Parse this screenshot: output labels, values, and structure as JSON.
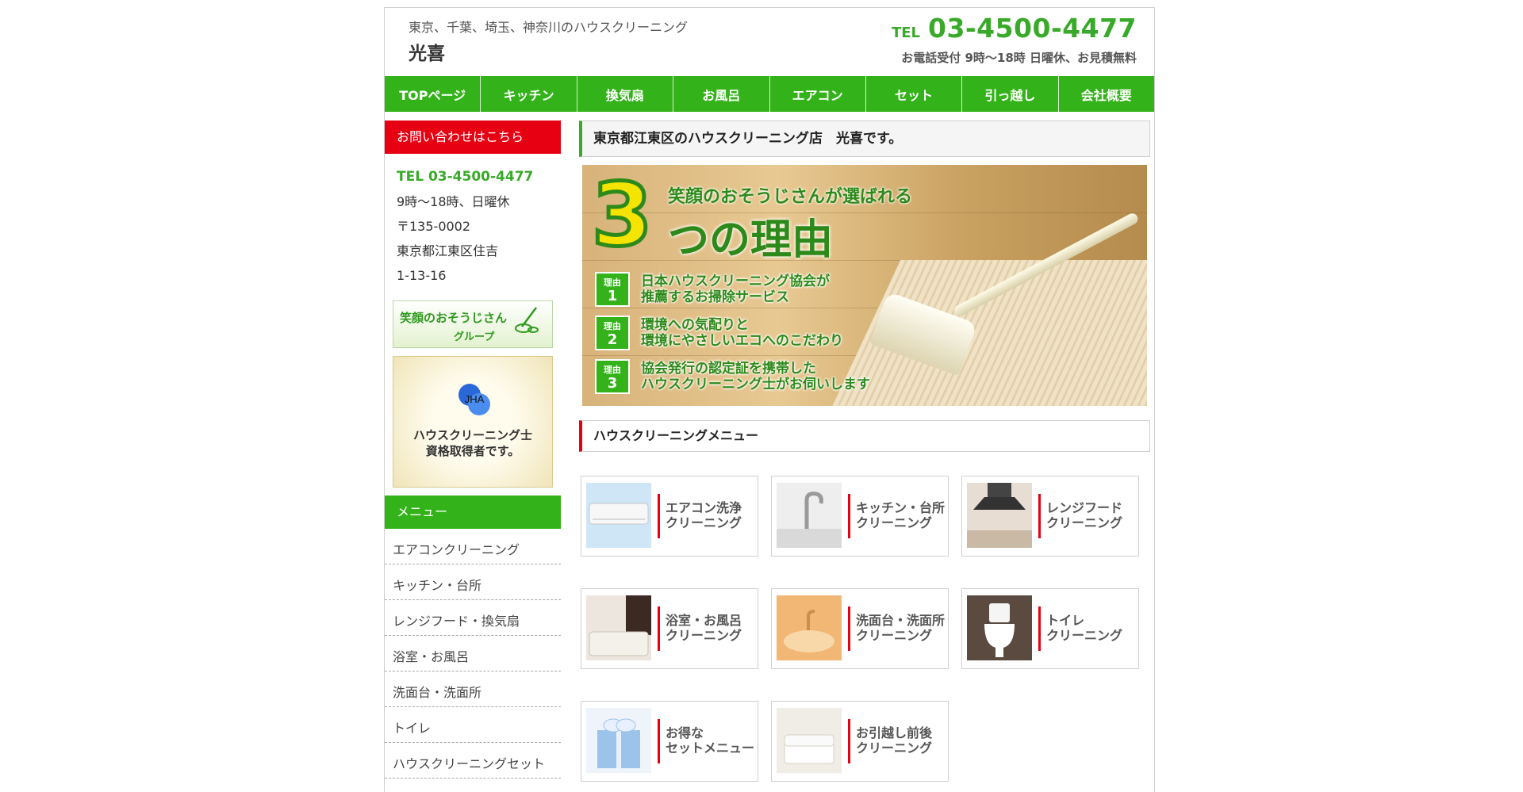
{
  "header": {
    "tagline": "東京、千葉、埼玉、神奈川のハウスクリーニング",
    "brand": "光喜",
    "tel_label": "TEL",
    "tel_number": "03-4500-4477",
    "tel_note": "お電話受付 9時～18時 日曜休、お見積無料"
  },
  "nav": [
    {
      "label": "TOPページ"
    },
    {
      "label": "キッチン"
    },
    {
      "label": "換気扇"
    },
    {
      "label": "お風呂"
    },
    {
      "label": "エアコン"
    },
    {
      "label": "セット"
    },
    {
      "label": "引っ越し"
    },
    {
      "label": "会社概要"
    }
  ],
  "sidebar": {
    "contact_heading": "お問い合わせはこちら",
    "tel": "TEL 03-4500-4477",
    "hours": "9時～18時、日曜休",
    "postal": "〒135-0002",
    "address1": "東京都江東区住吉",
    "address2": "1-13-16",
    "group_banner_line1": "笑顔のおそうじさん",
    "group_banner_line2": "グループ",
    "jha_logo_text": "JHA",
    "jha_title": "ハウスクリーニング士",
    "jha_sub": "資格取得者です。",
    "menu_heading": "メニュー",
    "menu_items": [
      {
        "label": "エアコンクリーニング"
      },
      {
        "label": "キッチン・台所"
      },
      {
        "label": "レンジフード・換気扇"
      },
      {
        "label": "浴室・お風呂"
      },
      {
        "label": "洗面台・洗面所"
      },
      {
        "label": "トイレ"
      },
      {
        "label": "ハウスクリーニングセット"
      }
    ]
  },
  "main": {
    "section_title": "東京都江東区のハウスクリーニング店　光喜です。",
    "hero": {
      "big_number": "3",
      "top_line": "笑顔のおそうじさんが選ばれる",
      "main_line": "つの理由",
      "reasons": [
        {
          "tag": "理由",
          "num": "1",
          "line1": "日本ハウスクリーニング協会が",
          "line2": "推薦するお掃除サービス"
        },
        {
          "tag": "理由",
          "num": "2",
          "line1": "環境への気配りと",
          "line2": "環境にやさしいエコへのこだわり"
        },
        {
          "tag": "理由",
          "num": "3",
          "line1": "協会発行の認定証を携帯した",
          "line2": "ハウスクリーニング士がお伺いします"
        }
      ]
    },
    "menu_title": "ハウスクリーニングメニュー",
    "cards": [
      {
        "label": "エアコン洗浄\nクリーニング",
        "icon": "air-conditioner"
      },
      {
        "label": "キッチン・台所\nクリーニング",
        "icon": "kitchen-faucet"
      },
      {
        "label": "レンジフード\nクリーニング",
        "icon": "range-hood"
      },
      {
        "label": "浴室・お風呂\nクリーニング",
        "icon": "bathtub"
      },
      {
        "label": "洗面台・洗面所\nクリーニング",
        "icon": "washbasin"
      },
      {
        "label": "トイレ\nクリーニング",
        "icon": "toilet"
      },
      {
        "label": "お得な\nセットメニュー",
        "icon": "gift-box"
      },
      {
        "label": "お引越し前後\nクリーニング",
        "icon": "empty-room"
      }
    ]
  }
}
